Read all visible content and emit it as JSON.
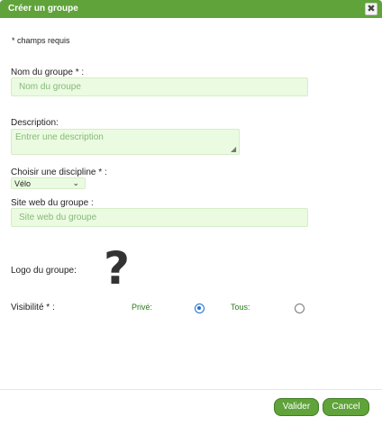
{
  "dialog": {
    "title": "Créer un groupe",
    "close_glyph": "✖"
  },
  "form": {
    "required_note": "* champs requis",
    "name": {
      "label": "Nom du groupe * :",
      "placeholder": "Nom du groupe",
      "value": ""
    },
    "description": {
      "label": "Description:",
      "placeholder": "Entrer une description",
      "value": ""
    },
    "discipline": {
      "label": "Choisir une discipline * :",
      "selected": "Vélo"
    },
    "website": {
      "label": "Site web du groupe :",
      "placeholder": "Site web du groupe",
      "value": ""
    },
    "logo": {
      "label": "Logo du groupe:",
      "glyph": "?"
    },
    "visibility": {
      "label": "Visibilité * :",
      "options": [
        {
          "label": "Privé:",
          "checked": true
        },
        {
          "label": "Tous:",
          "checked": false
        }
      ]
    }
  },
  "footer": {
    "submit_label": "Valider",
    "cancel_label": "Cancel"
  },
  "colors": {
    "accent": "#5fa33a",
    "field_bg": "#ebfbe1",
    "radio_checked": "#1f6ed4"
  }
}
